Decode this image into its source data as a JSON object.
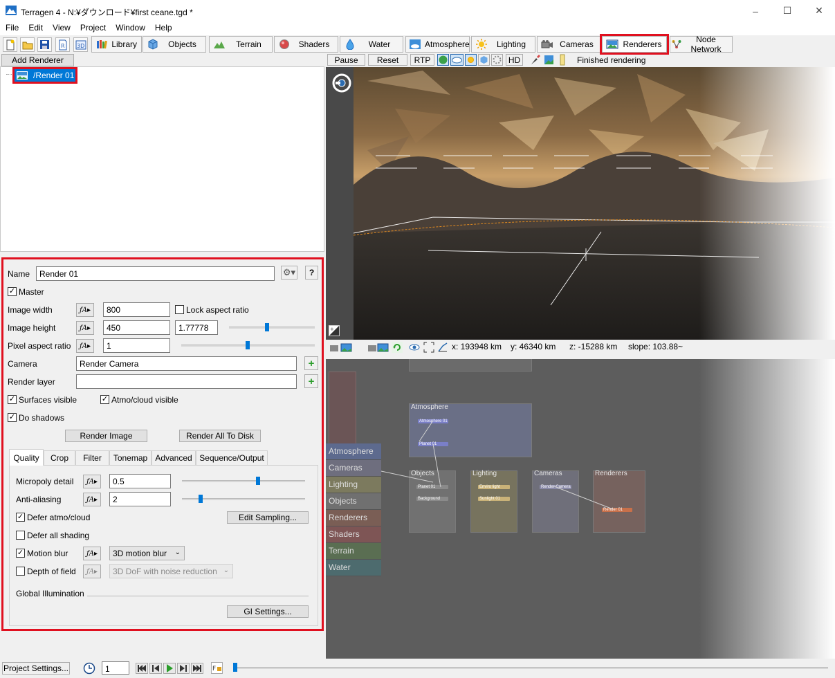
{
  "window": {
    "title": "Terragen 4 - N:¥ダウンロード¥first ceane.tgd *"
  },
  "menu": [
    "File",
    "Edit",
    "View",
    "Project",
    "Window",
    "Help"
  ],
  "toolbar_tabs": [
    {
      "label": "Library",
      "icon": "books-icon"
    },
    {
      "label": "Objects",
      "icon": "cube-icon"
    },
    {
      "label": "Terrain",
      "icon": "mountain-icon"
    },
    {
      "label": "Shaders",
      "icon": "sphere-icon"
    },
    {
      "label": "Water",
      "icon": "droplet-icon"
    },
    {
      "label": "Atmosphere",
      "icon": "sky-icon"
    },
    {
      "label": "Lighting",
      "icon": "sun-icon"
    },
    {
      "label": "Cameras",
      "icon": "camera-icon"
    },
    {
      "label": "Renderers",
      "icon": "image-icon"
    },
    {
      "label": "Node Network",
      "icon": "network-icon"
    }
  ],
  "left": {
    "add_renderer": "Add Renderer",
    "tree_item": "/Render 01"
  },
  "props": {
    "name_label": "Name",
    "name_value": "Render 01",
    "help": "?",
    "master": "Master",
    "image_width_label": "Image width",
    "image_width": "800",
    "lock_aspect": "Lock aspect ratio",
    "image_height_label": "Image height",
    "image_height": "450",
    "aspect_value": "1.77778",
    "pixel_aspect_label": "Pixel aspect ratio",
    "pixel_aspect": "1",
    "camera_label": "Camera",
    "camera_value": "Render Camera",
    "render_layer_label": "Render layer",
    "render_layer_value": "",
    "surfaces_visible": "Surfaces visible",
    "atmo_visible": "Atmo/cloud visible",
    "do_shadows": "Do shadows",
    "render_image": "Render Image",
    "render_all": "Render All To Disk"
  },
  "subtabs": [
    "Quality",
    "Crop",
    "Filter",
    "Tonemap",
    "Advanced",
    "Sequence/Output"
  ],
  "quality": {
    "micropoly_label": "Micropoly detail",
    "micropoly": "0.5",
    "antialias_label": "Anti-aliasing",
    "antialias": "2",
    "defer_atmo": "Defer atmo/cloud",
    "edit_sampling": "Edit Sampling...",
    "defer_all": "Defer all shading",
    "motion_blur": "Motion blur",
    "motion_blur_mode": "3D motion blur",
    "depth_of_field": "Depth of field",
    "dof_mode": "3D DoF with noise reduction",
    "gi_label": "Global Illumination",
    "gi_settings": "GI Settings..."
  },
  "render_toolbar": {
    "pause": "Pause",
    "reset": "Reset",
    "rtp": "RTP",
    "hd": "HD",
    "status": "Finished rendering"
  },
  "coords": {
    "x": "x: 193948 km",
    "y": "y: 46340 km",
    "z": "z: -15288 km",
    "slope": "slope: 103.88~"
  },
  "node_nav": [
    {
      "label": "Atmosphere",
      "color": "#5d6a8e"
    },
    {
      "label": "Cameras",
      "color": "#6e6e7e"
    },
    {
      "label": "Lighting",
      "color": "#7c7a5e"
    },
    {
      "label": "Objects",
      "color": "#707070"
    },
    {
      "label": "Renderers",
      "color": "#7a5e55"
    },
    {
      "label": "Shaders",
      "color": "#7e5555"
    },
    {
      "label": "Terrain",
      "color": "#5a6e52"
    },
    {
      "label": "Water",
      "color": "#4d6b6e"
    }
  ],
  "nodes": {
    "atmosphere": "Atmosphere",
    "objects": "Objects",
    "lighting": "Lighting",
    "cameras": "Cameras",
    "renderers": "Renderers",
    "atmo_pill1": "Atmosphere 01",
    "atmo_pill2": "Planet 01",
    "obj_pill1": "Planet 01",
    "obj_pill2": "Background",
    "light_pill1": "Enviro light",
    "light_pill2": "Sunlight 01",
    "cam_pill": "Render Camera",
    "rend_pill": "Render 01"
  },
  "bottom": {
    "project_settings": "Project Settings...",
    "frame": "1"
  }
}
